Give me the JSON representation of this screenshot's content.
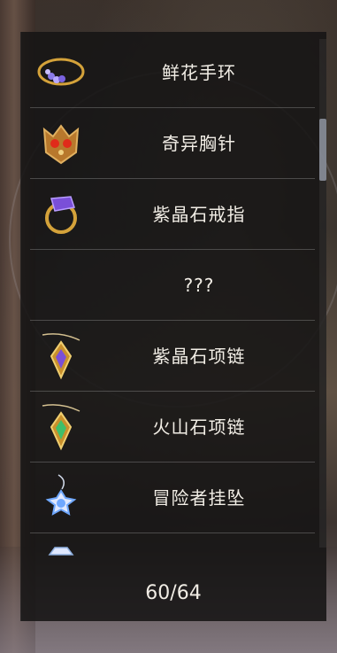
{
  "items": [
    {
      "label": "鲜花手环",
      "icon": "flower-bracelet-icon"
    },
    {
      "label": "奇异胸针",
      "icon": "strange-brooch-icon"
    },
    {
      "label": "紫晶石戒指",
      "icon": "amethyst-ring-icon"
    },
    {
      "label": "???",
      "icon": ""
    },
    {
      "label": "紫晶石项链",
      "icon": "amethyst-necklace-icon"
    },
    {
      "label": "火山石项链",
      "icon": "volcanic-stone-necklace-icon"
    },
    {
      "label": "冒险者挂坠",
      "icon": "adventurer-pendant-icon"
    },
    {
      "label": "",
      "icon": "partial-item-icon"
    }
  ],
  "progress": "60/64",
  "colors": {
    "panel": "#161414",
    "text": "#f2eee6",
    "gold": "#d4a23a",
    "amethyst": "#7a4fd8",
    "emerald": "#3fbf6a",
    "sapphire": "#6fa8ff"
  }
}
